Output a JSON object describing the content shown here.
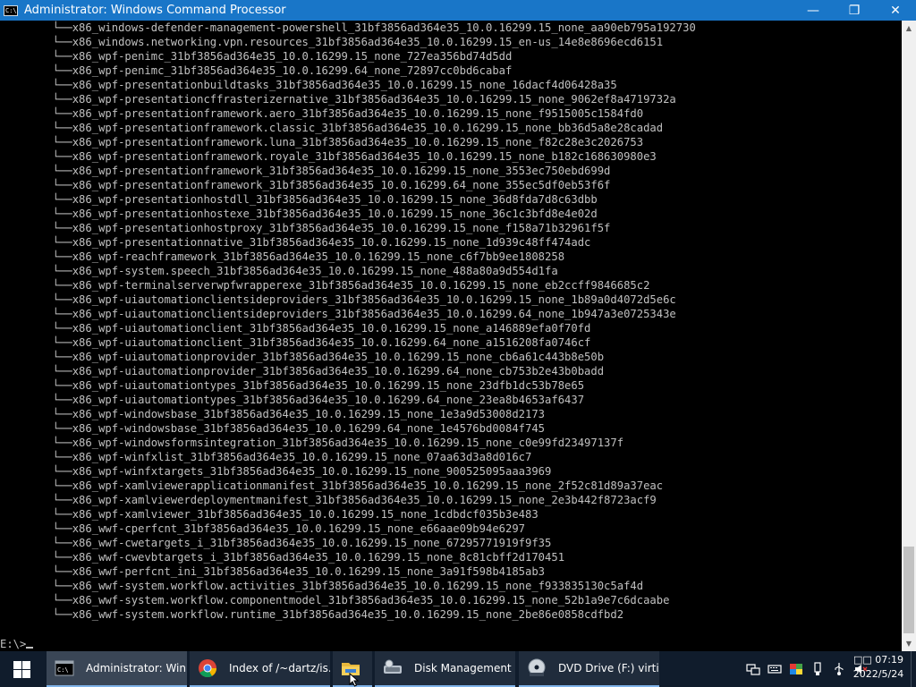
{
  "window": {
    "title": "Administrator: Windows Command Processor",
    "app_icon_text": "C:\\",
    "minimize_glyph": "—",
    "maximize_glyph": "❐",
    "close_glyph": "✕"
  },
  "console": {
    "tree_prefix": "        └──",
    "lines": [
      "x86_windows-defender-management-powershell_31bf3856ad364e35_10.0.16299.15_none_aa90eb795a192730",
      "x86_windows.networking.vpn.resources_31bf3856ad364e35_10.0.16299.15_en-us_14e8e8696ecd6151",
      "x86_wpf-penimc_31bf3856ad364e35_10.0.16299.15_none_727ea356bd74d5dd",
      "x86_wpf-penimc_31bf3856ad364e35_10.0.16299.64_none_72897cc0bd6cabaf",
      "x86_wpf-presentationbuildtasks_31bf3856ad364e35_10.0.16299.15_none_16dacf4d06428a35",
      "x86_wpf-presentationcffrasterizernative_31bf3856ad364e35_10.0.16299.15_none_9062ef8a4719732a",
      "x86_wpf-presentationframework.aero_31bf3856ad364e35_10.0.16299.15_none_f9515005c1584fd0",
      "x86_wpf-presentationframework.classic_31bf3856ad364e35_10.0.16299.15_none_bb36d5a8e28cadad",
      "x86_wpf-presentationframework.luna_31bf3856ad364e35_10.0.16299.15_none_f82c28e3c2026753",
      "x86_wpf-presentationframework.royale_31bf3856ad364e35_10.0.16299.15_none_b182c168630980e3",
      "x86_wpf-presentationframework_31bf3856ad364e35_10.0.16299.15_none_3553ec750ebd699d",
      "x86_wpf-presentationframework_31bf3856ad364e35_10.0.16299.64_none_355ec5df0eb53f6f",
      "x86_wpf-presentationhostdll_31bf3856ad364e35_10.0.16299.15_none_36d8fda7d8c63dbb",
      "x86_wpf-presentationhostexe_31bf3856ad364e35_10.0.16299.15_none_36c1c3bfd8e4e02d",
      "x86_wpf-presentationhostproxy_31bf3856ad364e35_10.0.16299.15_none_f158a71b32961f5f",
      "x86_wpf-presentationnative_31bf3856ad364e35_10.0.16299.15_none_1d939c48ff474adc",
      "x86_wpf-reachframework_31bf3856ad364e35_10.0.16299.15_none_c6f7bb9ee1808258",
      "x86_wpf-system.speech_31bf3856ad364e35_10.0.16299.15_none_488a80a9d554d1fa",
      "x86_wpf-terminalserverwpfwrapperexe_31bf3856ad364e35_10.0.16299.15_none_eb2ccff9846685c2",
      "x86_wpf-uiautomationclientsideproviders_31bf3856ad364e35_10.0.16299.15_none_1b89a0d4072d5e6c",
      "x86_wpf-uiautomationclientsideproviders_31bf3856ad364e35_10.0.16299.64_none_1b947a3e0725343e",
      "x86_wpf-uiautomationclient_31bf3856ad364e35_10.0.16299.15_none_a146889efa0f70fd",
      "x86_wpf-uiautomationclient_31bf3856ad364e35_10.0.16299.64_none_a1516208fa0746cf",
      "x86_wpf-uiautomationprovider_31bf3856ad364e35_10.0.16299.15_none_cb6a61c443b8e50b",
      "x86_wpf-uiautomationprovider_31bf3856ad364e35_10.0.16299.64_none_cb753b2e43b0badd",
      "x86_wpf-uiautomationtypes_31bf3856ad364e35_10.0.16299.15_none_23dfb1dc53b78e65",
      "x86_wpf-uiautomationtypes_31bf3856ad364e35_10.0.16299.64_none_23ea8b4653af6437",
      "x86_wpf-windowsbase_31bf3856ad364e35_10.0.16299.15_none_1e3a9d53008d2173",
      "x86_wpf-windowsbase_31bf3856ad364e35_10.0.16299.64_none_1e4576bd0084f745",
      "x86_wpf-windowsformsintegration_31bf3856ad364e35_10.0.16299.15_none_c0e99fd23497137f",
      "x86_wpf-winfxlist_31bf3856ad364e35_10.0.16299.15_none_07aa63d3a8d016c7",
      "x86_wpf-winfxtargets_31bf3856ad364e35_10.0.16299.15_none_900525095aaa3969",
      "x86_wpf-xamlviewerapplicationmanifest_31bf3856ad364e35_10.0.16299.15_none_2f52c81d89a37eac",
      "x86_wpf-xamlviewerdeploymentmanifest_31bf3856ad364e35_10.0.16299.15_none_2e3b442f8723acf9",
      "x86_wpf-xamlviewer_31bf3856ad364e35_10.0.16299.15_none_1cdbdcf035b3e483",
      "x86_wwf-cperfcnt_31bf3856ad364e35_10.0.16299.15_none_e66aae09b94e6297",
      "x86_wwf-cwetargets_i_31bf3856ad364e35_10.0.16299.15_none_67295771919f9f35",
      "x86_wwf-cwevbtargets_i_31bf3856ad364e35_10.0.16299.15_none_8c81cbff2d170451",
      "x86_wwf-perfcnt_ini_31bf3856ad364e35_10.0.16299.15_none_3a91f598b4185ab3",
      "x86_wwf-system.workflow.activities_31bf3856ad364e35_10.0.16299.15_none_f933835130c5af4d",
      "x86_wwf-system.workflow.componentmodel_31bf3856ad364e35_10.0.16299.15_none_52b1a9e7c6dcaabe",
      "x86_wwf-system.workflow.runtime_31bf3856ad364e35_10.0.16299.15_none_2be86e0858cdfbd2"
    ],
    "prompt": "E:\\>"
  },
  "taskbar": {
    "items": [
      {
        "label": "Administrator: Win...",
        "icon": "cmd-icon"
      },
      {
        "label": "Index of /~dartz/is...",
        "icon": "chrome-icon"
      },
      {
        "label": "",
        "icon": "file-explorer-icon"
      },
      {
        "label": "Disk Management",
        "icon": "disk-management-icon"
      },
      {
        "label": "DVD Drive (F:) virtio...",
        "icon": "dvd-drive-icon"
      }
    ],
    "tray_icons": [
      "network-icon",
      "keyboard-icon",
      "color-icon",
      "usb-icon",
      "usb-device-icon",
      "volume-muted-icon"
    ],
    "clock": {
      "time": "□□ 07:19",
      "date": "2022/5/24"
    }
  },
  "colors": {
    "titlebar": "#1976c8",
    "console_bg": "#000000",
    "console_text": "#c0c0c0",
    "taskbar": "#101c2c"
  }
}
